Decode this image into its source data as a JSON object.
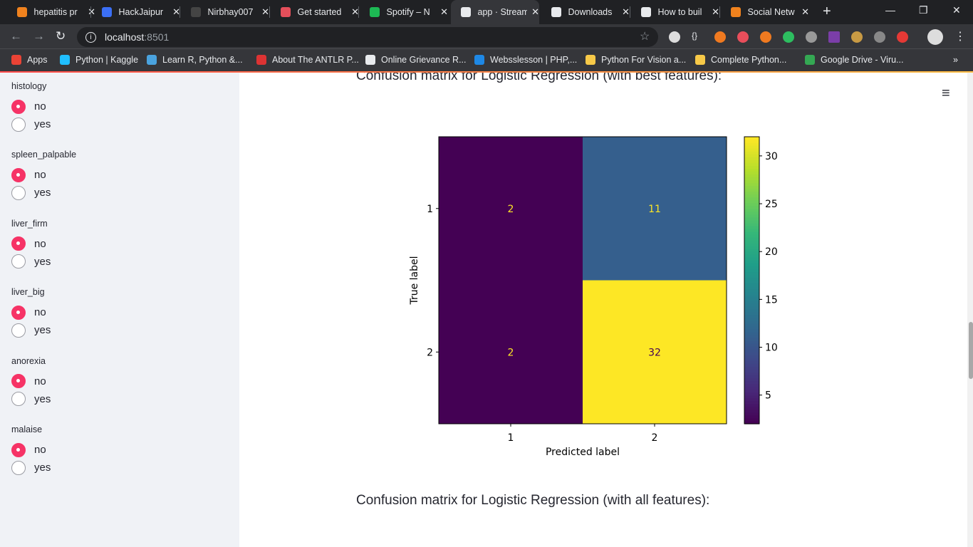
{
  "browser": {
    "tabs": [
      {
        "title": "hepatitis pr",
        "color": "#f0821e"
      },
      {
        "title": "HackJaipur",
        "color": "#3b6ff5"
      },
      {
        "title": "Nirbhay007",
        "color": "#444"
      },
      {
        "title": "Get started",
        "color": "#e54f5b"
      },
      {
        "title": "Spotify – N",
        "color": "#1db954"
      },
      {
        "title": "app · Stream",
        "color": "#e8eaed",
        "active": true
      },
      {
        "title": "Downloads",
        "color": "#e8eaed"
      },
      {
        "title": "How to buil",
        "color": "#e8eaed"
      },
      {
        "title": "Social Netw",
        "color": "#f0821e"
      }
    ],
    "close_glyph": "✕",
    "new_tab": "+",
    "window_controls": {
      "minimize": "—",
      "restore": "❐",
      "close": "✕"
    },
    "url_host": "localhost",
    "url_port": ":8501",
    "bookmarks": [
      {
        "label": "Apps",
        "color": "#ea4335"
      },
      {
        "label": "Python | Kaggle",
        "color": "#20beff"
      },
      {
        "label": "Learn R, Python &...",
        "color": "#4aa3df"
      },
      {
        "label": "About The ANTLR P...",
        "color": "#d33"
      },
      {
        "label": "Online Grievance R...",
        "color": "#e8eaed"
      },
      {
        "label": "Websslesson | PHP,...",
        "color": "#1e88e5"
      },
      {
        "label": "Python For Vision a...",
        "color": "#f7c948"
      },
      {
        "label": "Complete Python...",
        "color": "#f7c948"
      },
      {
        "label": "Google Drive - Viru...",
        "color": "#34a853"
      }
    ],
    "more_bookmarks": "»"
  },
  "sidebar": {
    "groups": [
      {
        "label": "histology",
        "options": [
          "no",
          "yes"
        ],
        "selected": "no"
      },
      {
        "label": "spleen_palpable",
        "options": [
          "no",
          "yes"
        ],
        "selected": "no"
      },
      {
        "label": "liver_firm",
        "options": [
          "no",
          "yes"
        ],
        "selected": "no"
      },
      {
        "label": "liver_big",
        "options": [
          "no",
          "yes"
        ],
        "selected": "no"
      },
      {
        "label": "anorexia",
        "options": [
          "no",
          "yes"
        ],
        "selected": "no"
      },
      {
        "label": "malaise",
        "options": [
          "no",
          "yes"
        ],
        "selected": "no"
      }
    ]
  },
  "main": {
    "heading_best": "Confusion matrix for Logistic Regression (with best features):",
    "heading_all": "Confusion matrix for Logistic Regression (with all features):",
    "menu_icon": "≡"
  },
  "chart_data": {
    "type": "heatmap",
    "colormap": "viridis",
    "xlabel": "Predicted label",
    "ylabel": "True label",
    "x_categories": [
      "1",
      "2"
    ],
    "y_categories": [
      "1",
      "2"
    ],
    "values": [
      [
        2,
        11
      ],
      [
        2,
        32
      ]
    ],
    "colorbar": {
      "range": [
        2,
        32
      ],
      "ticks": [
        5,
        10,
        15,
        20,
        25,
        30
      ]
    }
  }
}
